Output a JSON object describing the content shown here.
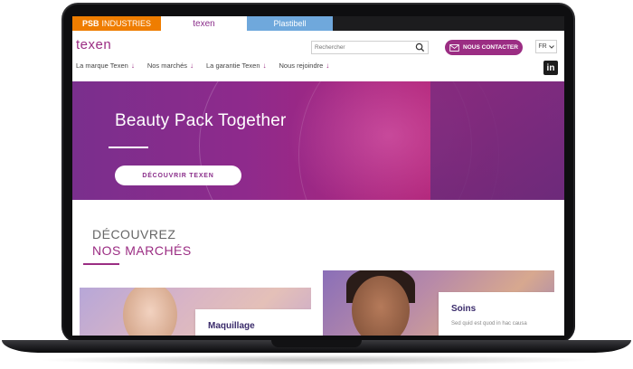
{
  "brand_tabs": {
    "psb_bold": "PSB",
    "psb_rest": "INDUSTRIES",
    "texen": "texen",
    "plastibell": "Plastibell"
  },
  "header": {
    "logo": "texen",
    "search_placeholder": "Rechercher",
    "contact_label": "NOUS CONTACTER",
    "lang_label": "FR",
    "linkedin": "in"
  },
  "menu": {
    "items": [
      {
        "label": "La marque Texen"
      },
      {
        "label": "Nos marchés"
      },
      {
        "label": "La garantie Texen"
      },
      {
        "label": "Nous rejoindre"
      }
    ]
  },
  "hero": {
    "title": "Beauty Pack Together",
    "button": "DÉCOUVRIR TEXEN"
  },
  "section": {
    "title_line1": "DÉCOUVREZ",
    "title_line2": "NOS MARCHÉS"
  },
  "cards": [
    {
      "title": "Maquillage",
      "text": ""
    },
    {
      "title": "Soins",
      "text": "Sed quid est quod in hac causa"
    }
  ],
  "colors": {
    "accent": "#9b2d83",
    "psb_orange": "#ef7d00",
    "plastibell_blue": "#6fa8dc"
  }
}
